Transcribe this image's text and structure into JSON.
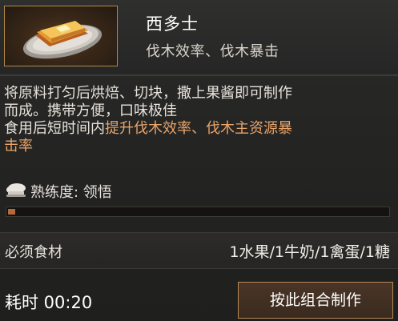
{
  "item": {
    "name": "西多士",
    "effect_summary": "伐木效率、伐木暴击",
    "icon": "french-toast-icon"
  },
  "description": {
    "line1": "将原料打匀后烘焙、切块，撒上果酱即可制作",
    "line2": "而成。携带方便，口味极佳",
    "line3_prefix": "食用后短时间内",
    "line3_highlight": "提升伐木效率、伐木主资源暴",
    "line4_highlight": "击率",
    "highlight_color": "#e8a46a"
  },
  "proficiency": {
    "label": "熟练度: 领悟",
    "icon": "chef-hat-icon",
    "progress": 0.02
  },
  "ingredients": {
    "label": "必须食材",
    "value": "1水果/1牛奶/1禽蛋/1糖"
  },
  "footer": {
    "time_label": "耗时 00:20",
    "craft_button": "按此组合制作"
  },
  "colors": {
    "accent_border": "#b48a47",
    "progress_fill": "#b26a3a"
  }
}
